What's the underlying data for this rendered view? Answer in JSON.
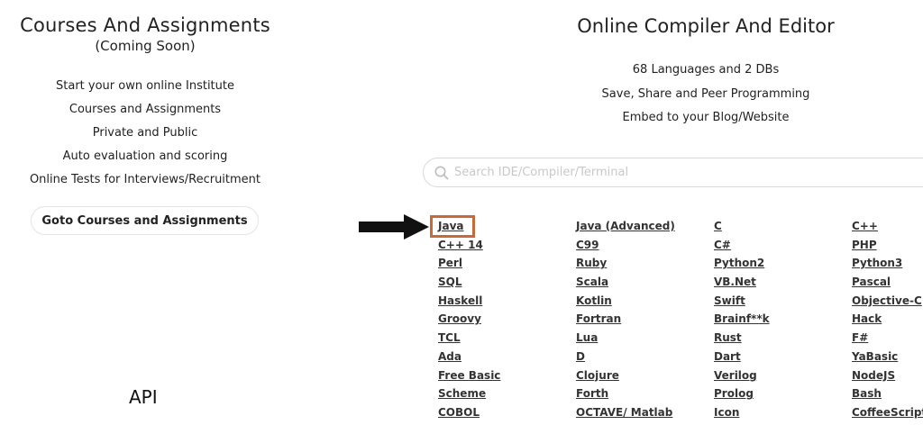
{
  "courses": {
    "title": "Courses And Assignments",
    "subtitle": "(Coming Soon)",
    "features": [
      "Start your own online Institute",
      "Courses and Assignments",
      "Private and Public",
      "Auto evaluation and scoring",
      "Online Tests for Interviews/Recruitment"
    ],
    "button_label": "Goto Courses and Assignments"
  },
  "api": {
    "label": "API"
  },
  "compiler": {
    "title": "Online Compiler And Editor",
    "features": [
      "68 Languages and 2 DBs",
      "Save, Share and Peer Programming",
      "Embed to your Blog/Website"
    ]
  },
  "search": {
    "placeholder": "Search IDE/Compiler/Terminal",
    "value": "",
    "icon": "search-icon"
  },
  "languages": [
    "Java",
    "Java (Advanced)",
    "C",
    "C++",
    "C++ 14",
    "C99",
    "C#",
    "PHP",
    "Perl",
    "Ruby",
    "Python2",
    "Python3",
    "SQL",
    "Scala",
    "VB.Net",
    "Pascal",
    "Haskell",
    "Kotlin",
    "Swift",
    "Objective-C",
    "Groovy",
    "Fortran",
    "Brainf**k",
    "Hack",
    "TCL",
    "Lua",
    "Rust",
    "F#",
    "Ada",
    "D",
    "Dart",
    "YaBasic",
    "Free Basic",
    "Clojure",
    "Verilog",
    "NodeJS",
    "Scheme",
    "Forth",
    "Prolog",
    "Bash",
    "COBOL",
    "OCTAVE/ Matlab",
    "Icon",
    "CoffeeScript"
  ],
  "annotation": {
    "highlighted_language": "Java",
    "highlight_color": "#c8693a",
    "arrow_color": "#111111",
    "arrow_icon": "arrow-right-icon"
  }
}
